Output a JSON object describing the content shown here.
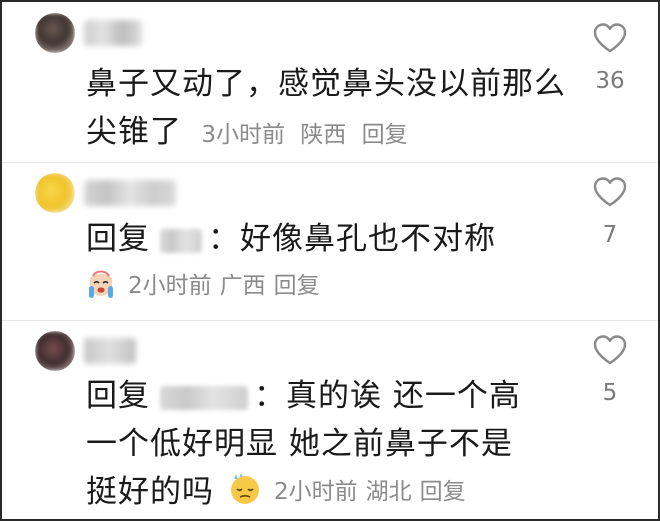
{
  "comments": [
    {
      "text": "鼻子又动了，感觉鼻头没以前那么尖锥了",
      "time": "3小时前",
      "location": "陕西",
      "reply_label": "回复",
      "likes": "36"
    },
    {
      "reply_prefix": "回复",
      "colon": "：",
      "text": "好像鼻孔也不对称",
      "time": "2小时前",
      "location": "广西",
      "reply_label": "回复",
      "likes": "7",
      "emoji": "crying-face-icon"
    },
    {
      "reply_prefix": "回复",
      "colon": "：",
      "text": "真的诶 还一个高一个低好明显 她之前鼻子不是挺好的吗",
      "time": "2小时前",
      "location": "湖北",
      "reply_label": "回复",
      "likes": "5",
      "emoji": "sweat-face-icon"
    }
  ],
  "colors": {
    "text": "#1a1a1a",
    "meta": "#8b8b8b",
    "heart_outline": "#8a8a8a"
  }
}
